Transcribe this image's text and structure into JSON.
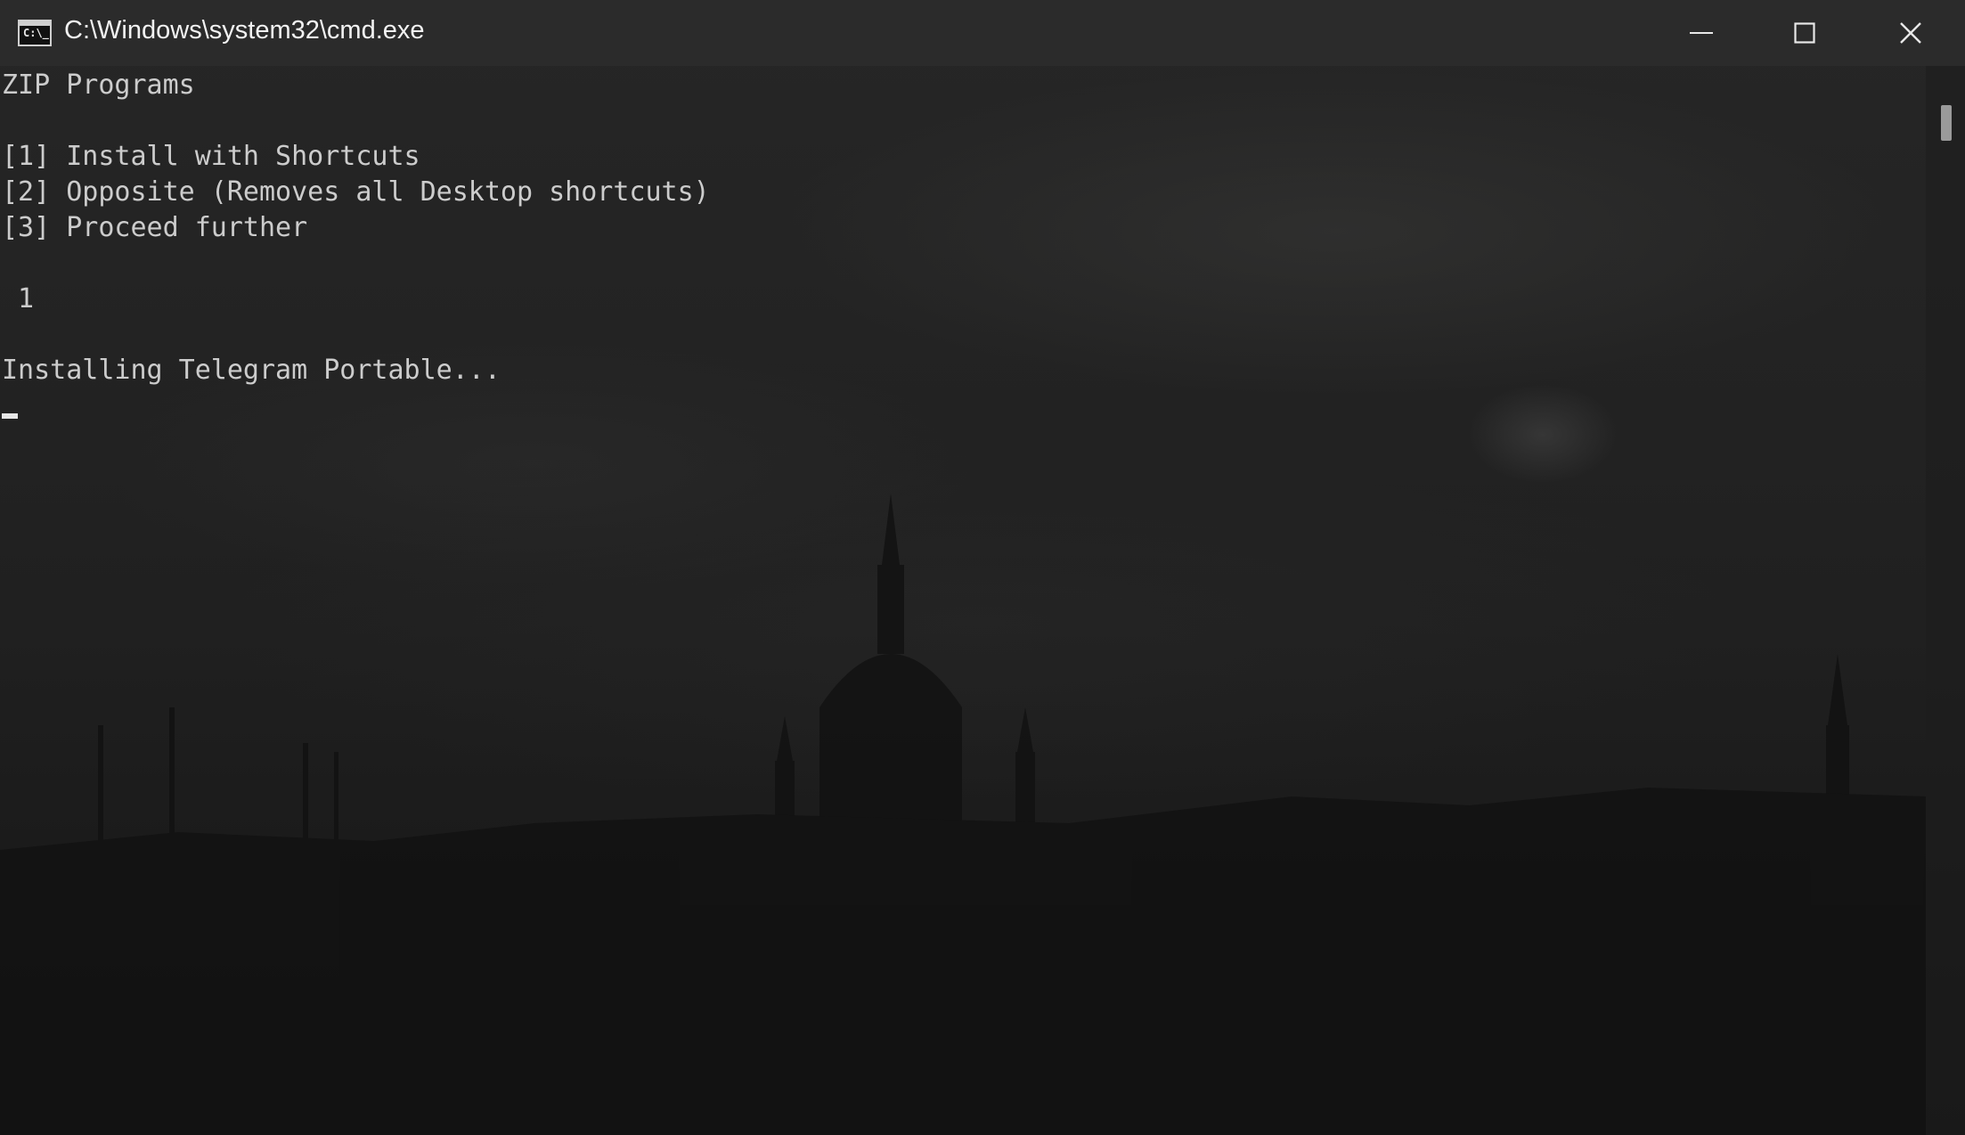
{
  "window": {
    "title": "C:\\Windows\\system32\\cmd.exe",
    "icon": "cmd-icon",
    "icon_text": "C:\\_"
  },
  "controls": {
    "minimize": "minimize-icon",
    "maximize": "maximize-icon",
    "close": "close-icon"
  },
  "console": {
    "lines": [
      "ZIP Programs",
      "",
      "[1] Install with Shortcuts",
      "[2] Opposite (Removes all Desktop shortcuts)",
      "[3] Proceed further",
      "",
      " 1",
      "",
      "Installing Telegram Portable..."
    ]
  },
  "colors": {
    "titlebar": "#2b2b2b",
    "text": "#cccccc",
    "background": "#1f1f1f"
  }
}
